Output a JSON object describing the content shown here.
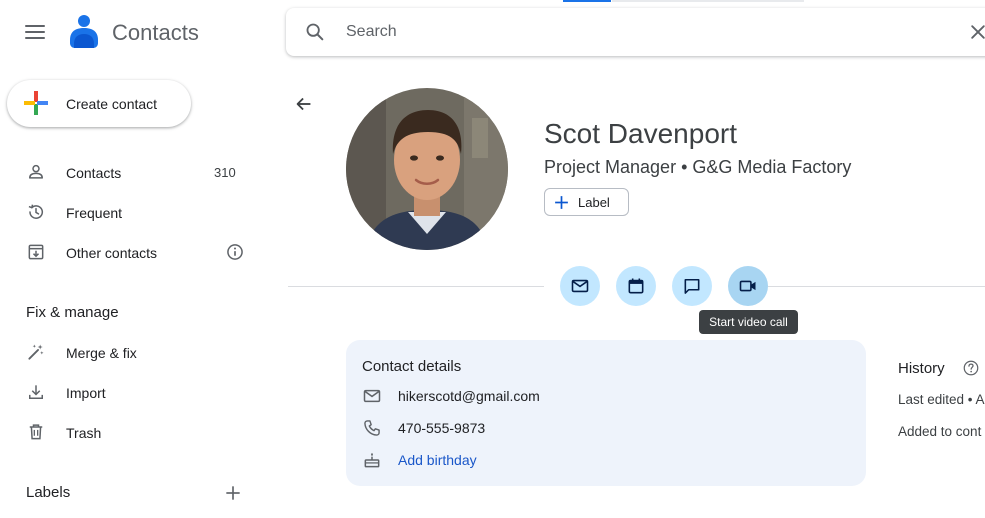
{
  "app": {
    "title": "Contacts"
  },
  "search": {
    "placeholder": "Search"
  },
  "create": {
    "label": "Create contact"
  },
  "nav": {
    "items": [
      {
        "label": "Contacts",
        "count": "310"
      },
      {
        "label": "Frequent"
      },
      {
        "label": "Other contacts"
      }
    ],
    "fix_title": "Fix & manage",
    "fix_items": [
      {
        "label": "Merge & fix"
      },
      {
        "label": "Import"
      },
      {
        "label": "Trash"
      }
    ],
    "labels_title": "Labels"
  },
  "contact": {
    "name": "Scot Davenport",
    "subtitle": "Project Manager • G&G Media Factory",
    "label_button": "Label"
  },
  "actions": {
    "icons": [
      "email-icon",
      "calendar-icon",
      "chat-icon",
      "video-call-icon"
    ],
    "tooltip": "Start video call"
  },
  "details": {
    "title": "Contact details",
    "email": "hikerscotd@gmail.com",
    "phone": "470-555-9873",
    "birthday": "Add birthday"
  },
  "history": {
    "title": "History",
    "last_edited": "Last edited • A",
    "added": "Added to cont"
  },
  "colors": {
    "accent": "#0b57d0",
    "action_bg": "#c2e7ff",
    "card_bg": "#eef3fb",
    "link": "#1a57c9",
    "tooltip_bg": "#3c4043"
  }
}
